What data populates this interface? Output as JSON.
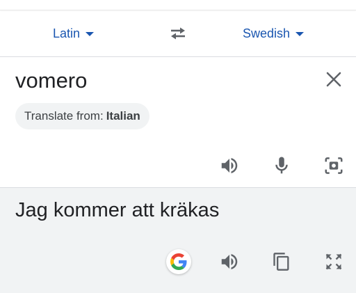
{
  "languages": {
    "source": "Latin",
    "target": "Swedish"
  },
  "input": {
    "text": "vomero",
    "detect_chip_prefix": "Translate from:",
    "detect_chip_language": "Italian"
  },
  "output": {
    "text": "Jag kommer att kräkas"
  },
  "icons": {
    "swap": "swap-languages-icon",
    "clear": "close-icon",
    "listen": "speaker-icon",
    "mic": "microphone-icon",
    "camera": "camera-icon",
    "google": "google-g-icon",
    "copy": "copy-icon",
    "fullscreen": "fullscreen-icon"
  },
  "colors": {
    "accent": "#1a56b0",
    "icon": "#5f6368",
    "output_bg": "#f1f3f4"
  }
}
